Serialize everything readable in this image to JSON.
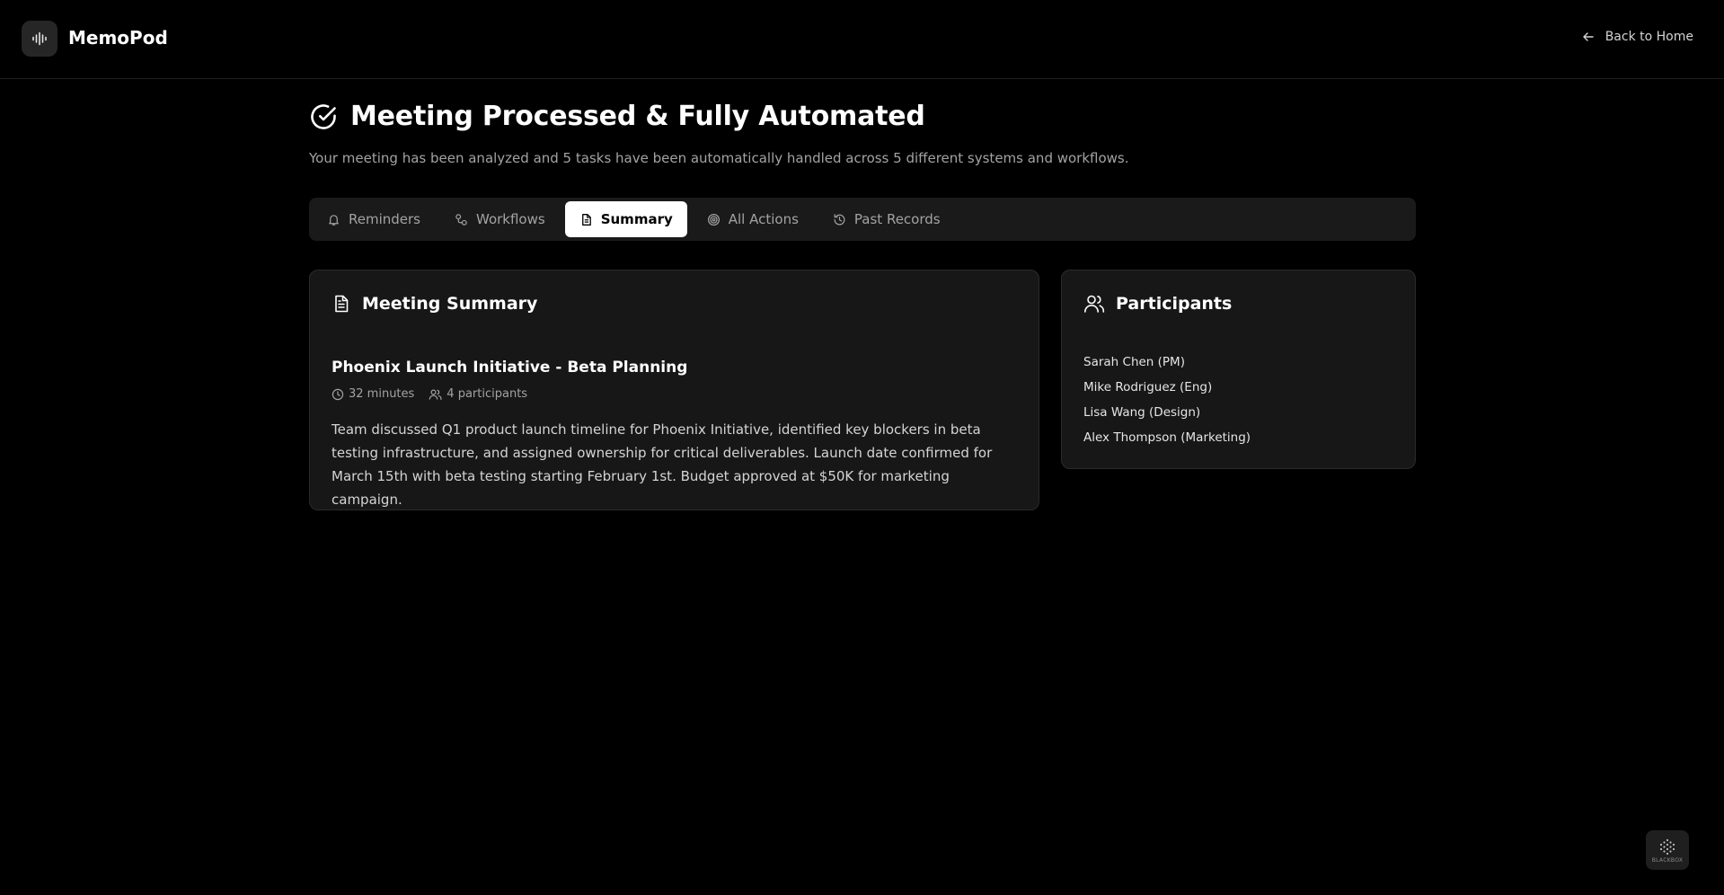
{
  "app": {
    "name": "MemoPod",
    "logo_icon": "audio-waveform-icon"
  },
  "header": {
    "back_label": "Back to Home",
    "back_icon": "arrow-left-icon"
  },
  "page": {
    "title": "Meeting Processed & Fully Automated",
    "title_icon": "check-circle-icon",
    "subtitle": "Your meeting has been analyzed and 5 tasks have been automatically handled across 5 different systems and workflows."
  },
  "tabs": [
    {
      "label": "Reminders",
      "icon": "bell-icon",
      "active": false
    },
    {
      "label": "Workflows",
      "icon": "workflow-icon",
      "active": false
    },
    {
      "label": "Summary",
      "icon": "file-text-icon",
      "active": true
    },
    {
      "label": "All Actions",
      "icon": "target-icon",
      "active": false
    },
    {
      "label": "Past Records",
      "icon": "history-icon",
      "active": false
    }
  ],
  "summary": {
    "heading": "Meeting Summary",
    "meeting_title": "Phoenix Launch Initiative - Beta Planning",
    "duration": "32 minutes",
    "participants_count": "4 participants",
    "text": "Team discussed Q1 product launch timeline for Phoenix Initiative, identified key blockers in beta testing infrastructure, and assigned ownership for critical deliverables. Launch date confirmed for March 15th with beta testing starting February 1st. Budget approved at $50K for marketing campaign."
  },
  "participants": {
    "heading": "Participants",
    "people": [
      "Sarah Chen (PM)",
      "Mike Rodriguez (Eng)",
      "Lisa Wang (Design)",
      "Alex Thompson (Marketing)"
    ]
  },
  "badge": {
    "label": "BLACKBOX"
  },
  "colors": {
    "background": "#000000",
    "card": "#171717",
    "tab_bar": "#1a1a1a",
    "active_tab": "#ffffff",
    "muted_text": "#a3a3a3"
  }
}
